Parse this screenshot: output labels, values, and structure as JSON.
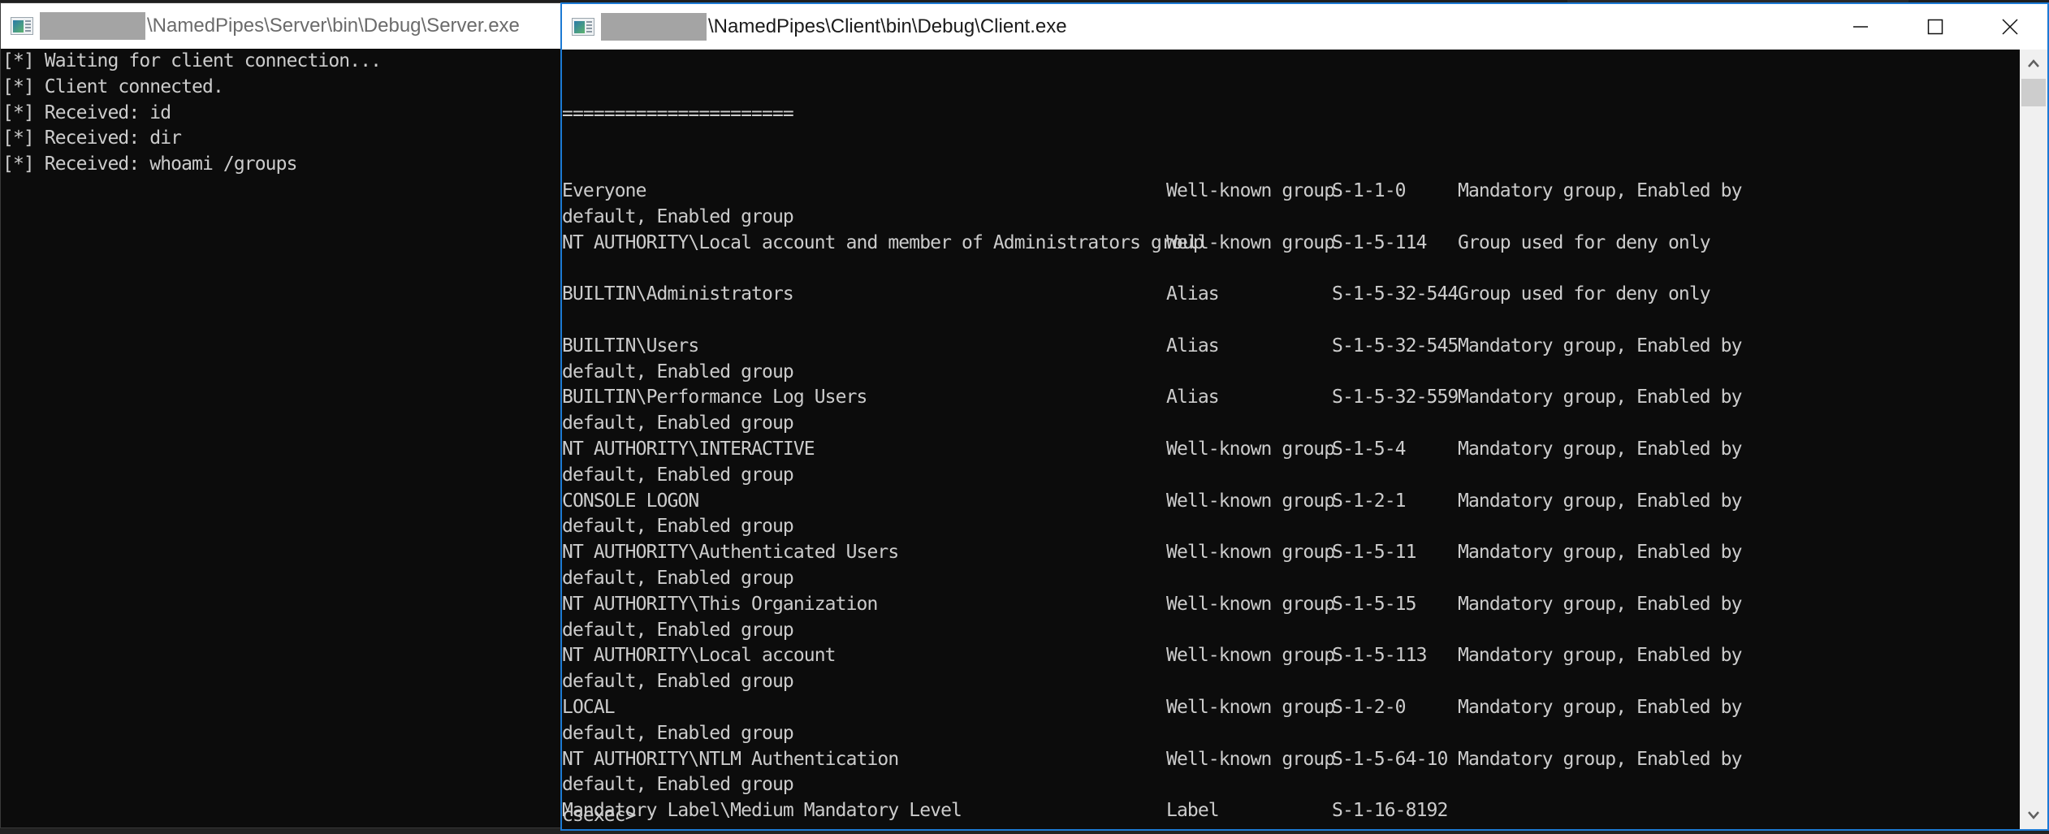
{
  "background_window": {
    "title_fragment": "..."
  },
  "server_window": {
    "title_redacted": true,
    "title": "\\NamedPipes\\Server\\bin\\Debug\\Server.exe",
    "icon": "console-app-icon",
    "lines": [
      "[*] Waiting for client connection...",
      "[*] Client connected.",
      "[*] Received: id",
      "[*] Received: dir",
      "[*] Received: whoami /groups"
    ]
  },
  "client_window": {
    "title_redacted": true,
    "title": "\\NamedPipes\\Client\\bin\\Debug\\Client.exe",
    "icon": "console-app-icon",
    "controls": {
      "minimize": "minimize-icon",
      "maximize": "maximize-icon",
      "close": "close-icon"
    },
    "separator": "======================",
    "groups": [
      {
        "name": "Everyone",
        "type": "Well-known group",
        "sid": "S-1-1-0",
        "attributes": "Mandatory group, Enabled by",
        "wrap": "default, Enabled group"
      },
      {
        "name": "NT AUTHORITY\\Local account and member of Administrators group",
        "type": "Well-known group",
        "sid": "S-1-5-114",
        "attributes": "Group used for deny only",
        "wrap": ""
      },
      {
        "name": "BUILTIN\\Administrators",
        "type": "Alias",
        "sid": "S-1-5-32-544",
        "attributes": "Group used for deny only",
        "wrap": ""
      },
      {
        "name": "BUILTIN\\Users",
        "type": "Alias",
        "sid": "S-1-5-32-545",
        "attributes": "Mandatory group, Enabled by",
        "wrap": "default, Enabled group"
      },
      {
        "name": "BUILTIN\\Performance Log Users",
        "type": "Alias",
        "sid": "S-1-5-32-559",
        "attributes": "Mandatory group, Enabled by",
        "wrap": "default, Enabled group"
      },
      {
        "name": "NT AUTHORITY\\INTERACTIVE",
        "type": "Well-known group",
        "sid": "S-1-5-4",
        "attributes": "Mandatory group, Enabled by",
        "wrap": "default, Enabled group"
      },
      {
        "name": "CONSOLE LOGON",
        "type": "Well-known group",
        "sid": "S-1-2-1",
        "attributes": "Mandatory group, Enabled by",
        "wrap": "default, Enabled group"
      },
      {
        "name": "NT AUTHORITY\\Authenticated Users",
        "type": "Well-known group",
        "sid": "S-1-5-11",
        "attributes": "Mandatory group, Enabled by",
        "wrap": "default, Enabled group"
      },
      {
        "name": "NT AUTHORITY\\This Organization",
        "type": "Well-known group",
        "sid": "S-1-5-15",
        "attributes": "Mandatory group, Enabled by",
        "wrap": "default, Enabled group"
      },
      {
        "name": "NT AUTHORITY\\Local account",
        "type": "Well-known group",
        "sid": "S-1-5-113",
        "attributes": "Mandatory group, Enabled by",
        "wrap": "default, Enabled group"
      },
      {
        "name": "LOCAL",
        "type": "Well-known group",
        "sid": "S-1-2-0",
        "attributes": "Mandatory group, Enabled by",
        "wrap": "default, Enabled group"
      },
      {
        "name": "NT AUTHORITY\\NTLM Authentication",
        "type": "Well-known group",
        "sid": "S-1-5-64-10",
        "attributes": "Mandatory group, Enabled by",
        "wrap": "default, Enabled group"
      },
      {
        "name": "Mandatory Label\\Medium Mandatory Level",
        "type": "Label",
        "sid": "S-1-16-8192",
        "attributes": "",
        "wrap": null
      }
    ],
    "prompt": "csexec>",
    "scrollbar": {
      "position_fraction": 0.0,
      "up_icon": "chevron-up-icon",
      "down_icon": "chevron-down-icon"
    }
  }
}
